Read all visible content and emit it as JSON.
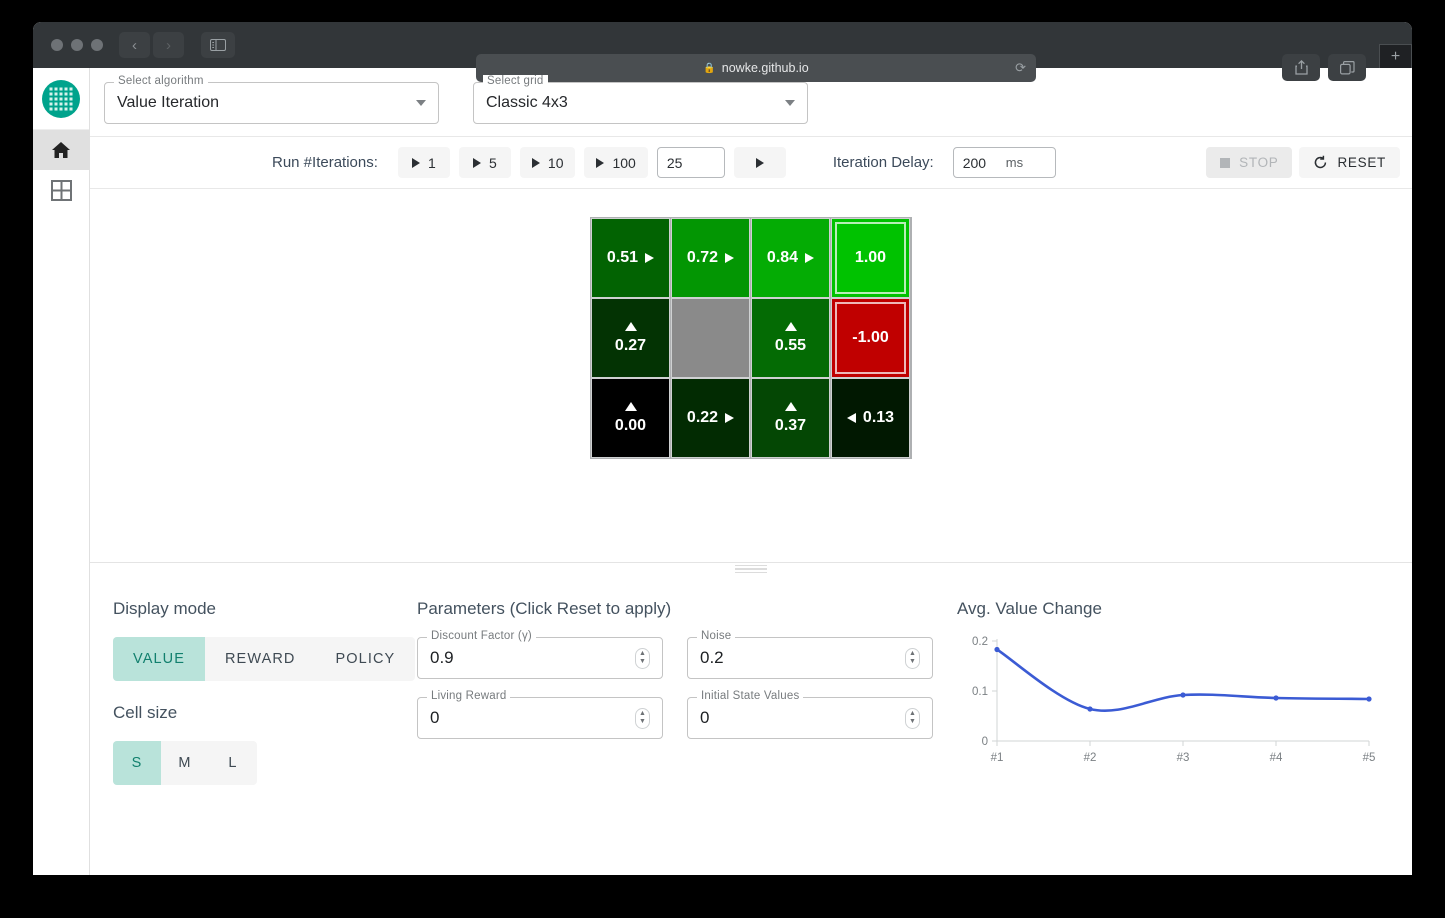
{
  "browser": {
    "url": "nowke.github.io",
    "lock_icon": "lock-icon",
    "back_icon": "chevron-left-icon",
    "forward_icon": "chevron-right-icon",
    "sidebar_icon": "sidebar-toggle-icon",
    "reload_icon": "reload-icon",
    "share_icon": "share-icon",
    "tabs_icon": "tab-overview-icon",
    "newtab_label": "+"
  },
  "sidebar": {
    "logo_name": "app-logo",
    "items": [
      {
        "icon": "home-icon",
        "name": "sidebar-item-home",
        "active": true
      },
      {
        "icon": "grid-icon",
        "name": "sidebar-item-grid",
        "active": false
      }
    ]
  },
  "selectors": {
    "algorithm": {
      "legend": "Select algorithm",
      "value": "Value Iteration"
    },
    "grid": {
      "legend": "Select grid",
      "value": "Classic 4x3"
    }
  },
  "toolbar": {
    "run_label": "Run #Iterations:",
    "run_buttons": [
      "1",
      "5",
      "10",
      "100"
    ],
    "custom_iterations": "25",
    "custom_run_icon": "play-icon",
    "delay_label": "Iteration Delay:",
    "delay_value": "200",
    "delay_unit": "ms",
    "stop_label": "STOP",
    "stop_icon": "stop-square-icon",
    "reset_label": "RESET",
    "reset_icon": "refresh-icon"
  },
  "grid": {
    "rows": 3,
    "cols": 4,
    "cells": [
      {
        "value": "0.51",
        "arrow": "right",
        "bg": "#026302",
        "type": "normal"
      },
      {
        "value": "0.72",
        "arrow": "right",
        "bg": "#039603",
        "type": "normal"
      },
      {
        "value": "0.84",
        "arrow": "right",
        "bg": "#04ac04",
        "type": "normal"
      },
      {
        "value": "1.00",
        "arrow": "none",
        "bg": "#00c200",
        "type": "terminal-positive"
      },
      {
        "value": "0.27",
        "arrow": "up",
        "bg": "#033303",
        "type": "normal"
      },
      {
        "value": "",
        "arrow": "none",
        "bg": "#8a8a8a",
        "type": "wall"
      },
      {
        "value": "0.55",
        "arrow": "up",
        "bg": "#046b04",
        "type": "normal"
      },
      {
        "value": "-1.00",
        "arrow": "none",
        "bg": "#c00000",
        "type": "terminal-negative"
      },
      {
        "value": "0.00",
        "arrow": "up",
        "bg": "#000000",
        "type": "normal"
      },
      {
        "value": "0.22",
        "arrow": "right",
        "bg": "#022b02",
        "type": "normal"
      },
      {
        "value": "0.37",
        "arrow": "up",
        "bg": "#044704",
        "type": "normal"
      },
      {
        "value": "0.13",
        "arrow": "left",
        "bg": "#011801",
        "type": "normal"
      }
    ]
  },
  "display_mode": {
    "title": "Display mode",
    "options": [
      "VALUE",
      "REWARD",
      "POLICY"
    ],
    "selected": "VALUE"
  },
  "cell_size": {
    "title": "Cell size",
    "options": [
      "S",
      "M",
      "L"
    ],
    "selected": "S"
  },
  "parameters": {
    "title": "Parameters (Click Reset to apply)",
    "fields": [
      {
        "legend": "Discount Factor (γ)",
        "value": "0.9",
        "name": "discount-factor-input"
      },
      {
        "legend": "Noise",
        "value": "0.2",
        "name": "noise-input"
      },
      {
        "legend": "Living Reward",
        "value": "0",
        "name": "living-reward-input"
      },
      {
        "legend": "Initial State Values",
        "value": "0",
        "name": "initial-state-values-input"
      }
    ]
  },
  "chart_data": {
    "type": "line",
    "title": "Avg. Value Change",
    "categories": [
      "#1",
      "#2",
      "#3",
      "#4",
      "#5"
    ],
    "values": [
      0.183,
      0.064,
      0.092,
      0.086,
      0.084
    ],
    "xlabel": "",
    "ylabel": "",
    "ylim": [
      0,
      0.2
    ],
    "yticks": [
      "0",
      "0.1",
      "0.2"
    ],
    "ytick_values": [
      0,
      0.1,
      0.2
    ],
    "grid": false,
    "legend": "none",
    "line_color": "#3b5bd4",
    "smooth": true
  },
  "theme": {
    "accent": "#00a38c",
    "toggle_selected_bg": "#b9e3da",
    "toggle_selected_fg": "#12806e",
    "chrome_bg": "#323639"
  }
}
